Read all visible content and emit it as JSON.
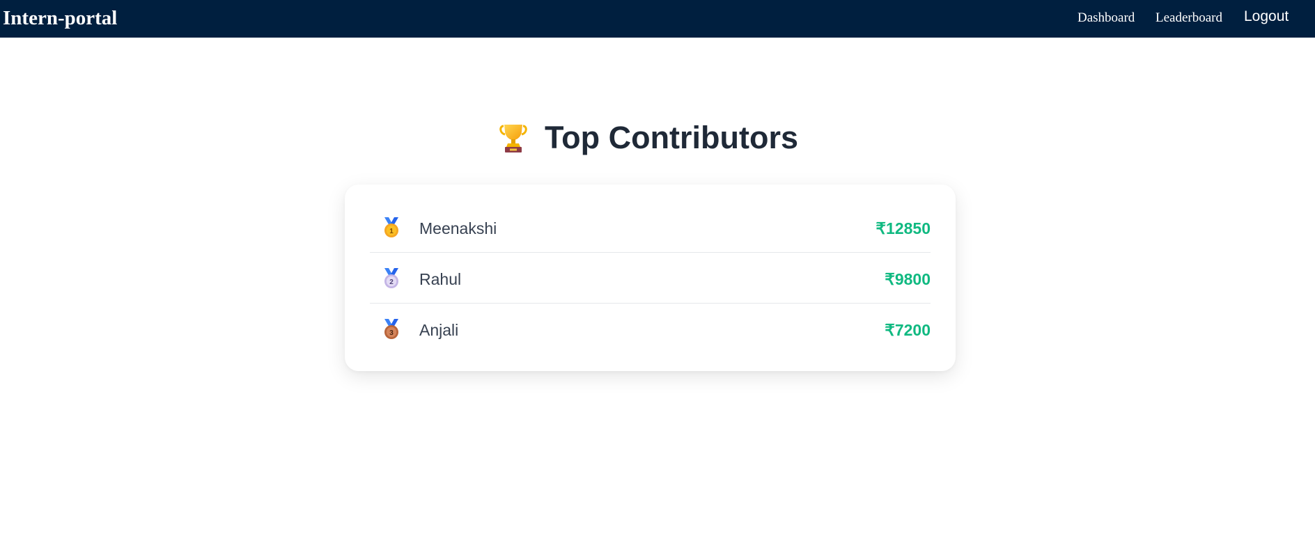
{
  "navbar": {
    "brand": "Intern-portal",
    "links": [
      {
        "label": "Dashboard"
      },
      {
        "label": "Leaderboard"
      }
    ],
    "logout_label": "Logout",
    "background": "#001f3f"
  },
  "main": {
    "title_icon": "trophy-icon",
    "title": "Top Contributors"
  },
  "leaderboard": {
    "amount_color": "#10b981",
    "entries": [
      {
        "rank_icon": "gold-medal-icon",
        "rank": "1",
        "name": "Meenakshi",
        "amount": "₹12850"
      },
      {
        "rank_icon": "silver-medal-icon",
        "rank": "2",
        "name": "Rahul",
        "amount": "₹9800"
      },
      {
        "rank_icon": "bronze-medal-icon",
        "rank": "3",
        "name": "Anjali",
        "amount": "₹7200"
      }
    ]
  }
}
